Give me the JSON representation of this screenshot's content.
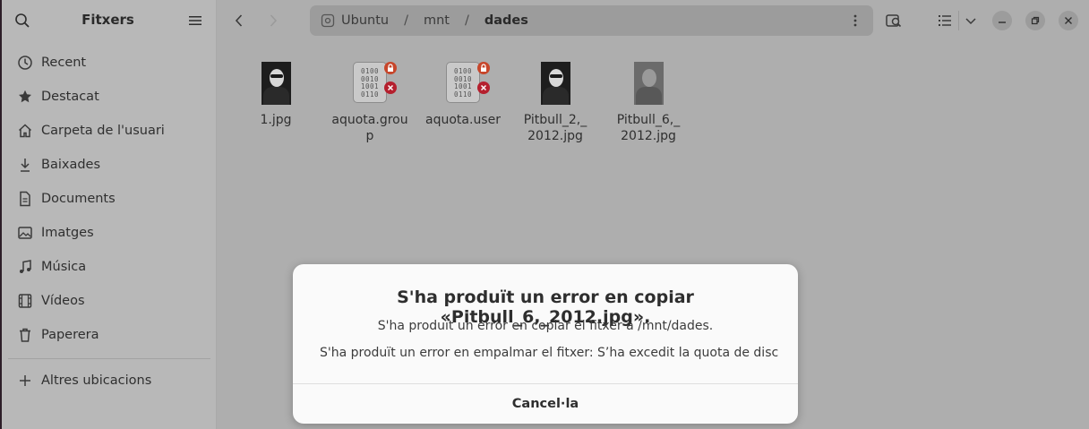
{
  "sidebar": {
    "title": "Fitxers",
    "items": [
      {
        "label": "Recent",
        "icon": "clock-icon"
      },
      {
        "label": "Destacat",
        "icon": "star-icon"
      },
      {
        "label": "Carpeta de l'usuari",
        "icon": "home-icon"
      },
      {
        "label": "Baixades",
        "icon": "download-icon"
      },
      {
        "label": "Documents",
        "icon": "document-icon"
      },
      {
        "label": "Imatges",
        "icon": "image-icon"
      },
      {
        "label": "Música",
        "icon": "music-icon"
      },
      {
        "label": "Vídeos",
        "icon": "video-icon"
      },
      {
        "label": "Paperera",
        "icon": "trash-icon"
      }
    ],
    "other_locations": "Altres ubicacions"
  },
  "pathbar": {
    "segments": [
      "Ubuntu",
      "mnt"
    ],
    "current": "dades",
    "separator": "/"
  },
  "files": [
    {
      "name": "1.jpg",
      "type": "photo"
    },
    {
      "name": "aquota.group",
      "type": "binary",
      "locked": true,
      "error": true
    },
    {
      "name": "aquota.user",
      "type": "binary",
      "locked": true,
      "error": true
    },
    {
      "name": "Pitbull_2,_2012.jpg",
      "type": "photo"
    },
    {
      "name": "Pitbull_6,_2012.jpg",
      "type": "photo-grey"
    }
  ],
  "binary_glyph": [
    "0100",
    "0010",
    "1001",
    "0110"
  ],
  "dialog": {
    "title": "S'ha produït un error en copiar «Pitbull_6,_2012.jpg».",
    "message": "S'ha produït un error en copiar el fitxer a /mnt/dades.",
    "detail": "S'ha produït un error en empalmar el fitxer: S’ha excedit la quota de disc",
    "cancel_label": "Cancel·la"
  },
  "colors": {
    "overlay_bg": "#aeaeae",
    "sidebar_bg": "#b8b8b8",
    "dialog_bg": "#fafafa",
    "lock_emblem": "#c7462b",
    "error_emblem": "#b5202e"
  }
}
